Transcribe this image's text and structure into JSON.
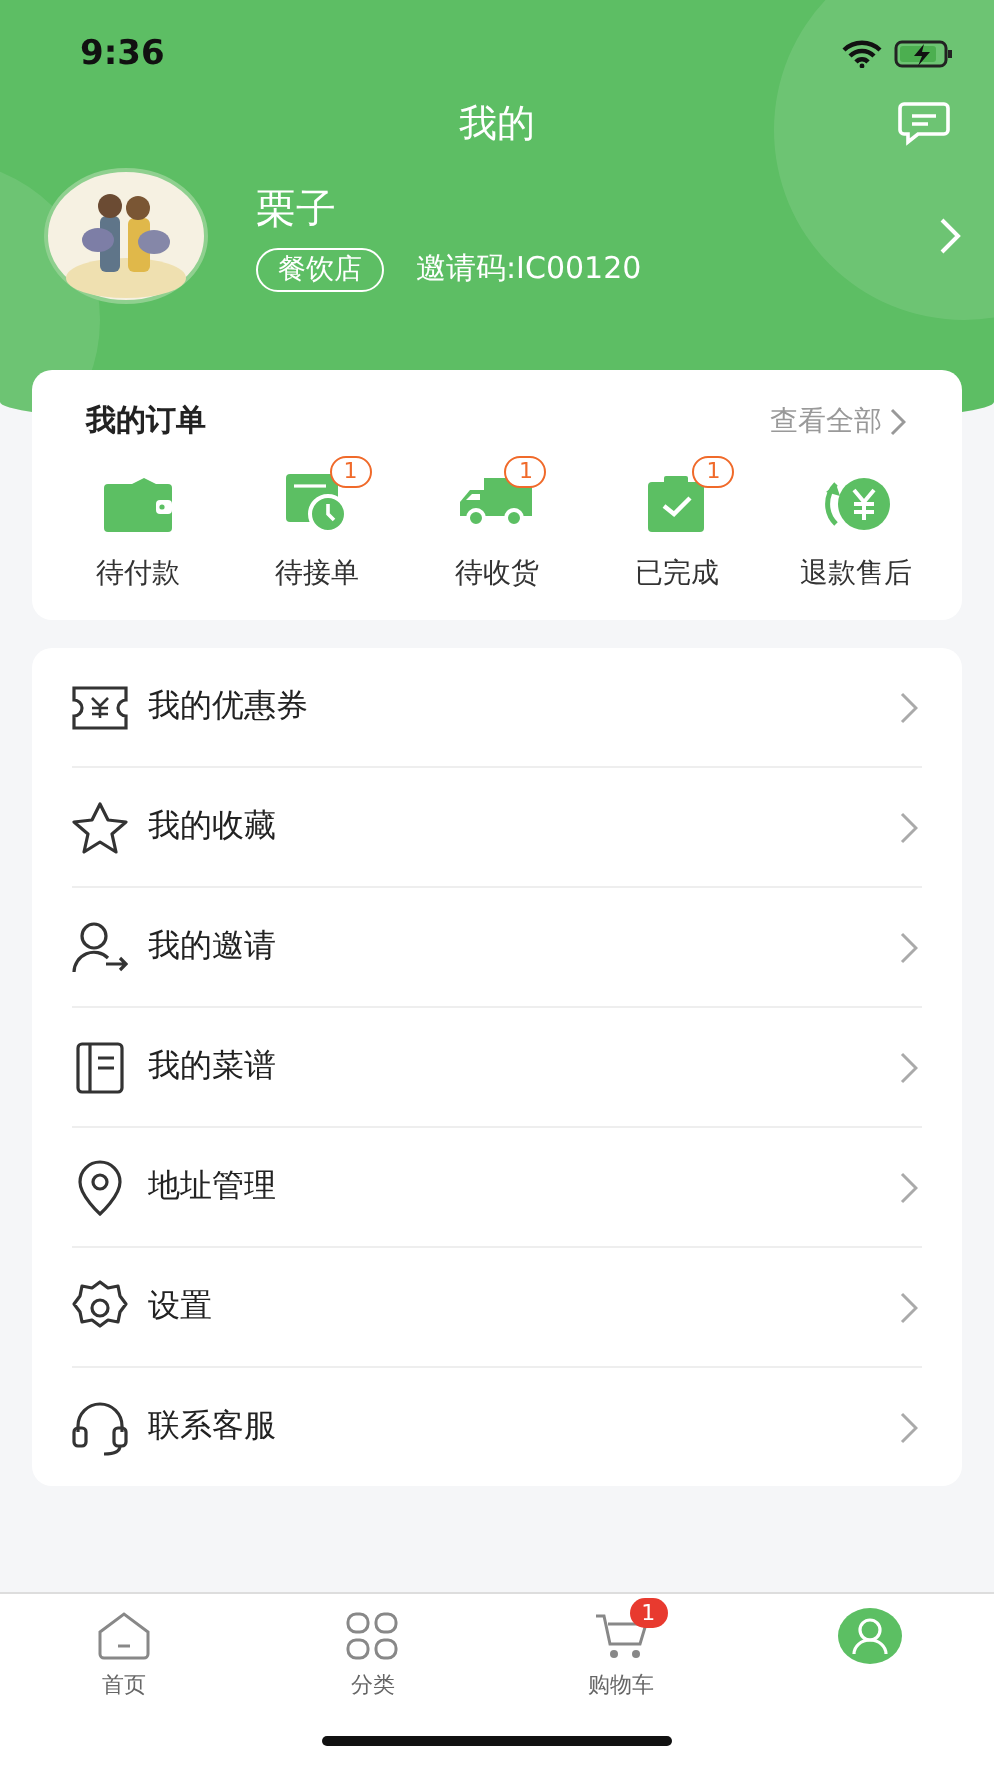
{
  "status_bar": {
    "time": "9:36"
  },
  "header": {
    "title": "我的"
  },
  "profile": {
    "name": "栗子",
    "tag": "餐饮店",
    "invite_code": "邀请码:IC00120"
  },
  "orders": {
    "title": "我的订单",
    "view_all": "查看全部",
    "items": [
      {
        "kind": "wallet",
        "label": "待付款"
      },
      {
        "kind": "pending",
        "label": "待接单",
        "badge": "1"
      },
      {
        "kind": "truck",
        "label": "待收货",
        "badge": "1"
      },
      {
        "kind": "done",
        "label": "已完成",
        "badge": "1"
      },
      {
        "kind": "refund",
        "label": "退款售后"
      }
    ]
  },
  "menu": [
    {
      "kind": "coupon",
      "label": "我的优惠券"
    },
    {
      "kind": "star",
      "label": "我的收藏"
    },
    {
      "kind": "invite",
      "label": "我的邀请"
    },
    {
      "kind": "recipe",
      "label": "我的菜谱"
    },
    {
      "kind": "address",
      "label": "地址管理"
    },
    {
      "kind": "settings",
      "label": "设置"
    },
    {
      "kind": "service",
      "label": "联系客服"
    }
  ],
  "tab_bar": [
    {
      "kind": "home",
      "label": "首页",
      "selected": false
    },
    {
      "kind": "category",
      "label": "分类",
      "selected": false
    },
    {
      "kind": "cart",
      "label": "购物车",
      "badge": "1",
      "selected": false
    },
    {
      "kind": "mine",
      "selected": true
    }
  ]
}
